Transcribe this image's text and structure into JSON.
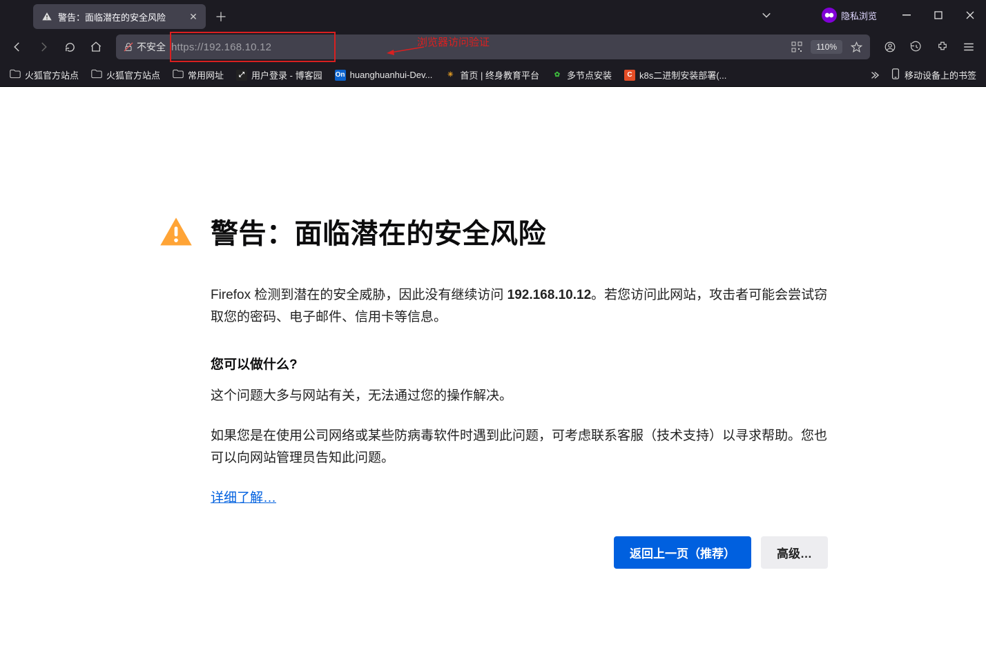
{
  "tab": {
    "title": "警告：面临潜在的安全风险"
  },
  "private_label": "隐私浏览",
  "urlbar": {
    "insecure_label": "不安全",
    "url": "https://192.168.10.12",
    "zoom": "110%"
  },
  "callout": "浏览器访问验证",
  "bookmarks": [
    {
      "label": "火狐官方站点",
      "type": "folder"
    },
    {
      "label": "火狐官方站点",
      "type": "folder"
    },
    {
      "label": "常用网址",
      "type": "folder"
    },
    {
      "label": "用户登录 - 博客园",
      "type": "link",
      "favbg": "#222",
      "favtxt": "⤢",
      "favcolor": "#fff"
    },
    {
      "label": "huanghuanhui-Dev...",
      "type": "link",
      "favbg": "#0b63ce",
      "favtxt": "On",
      "favcolor": "#fff"
    },
    {
      "label": "首页 | 终身教育平台",
      "type": "link",
      "favbg": "transparent",
      "favtxt": "✳",
      "favcolor": "#d92"
    },
    {
      "label": "多节点安装",
      "type": "link",
      "favbg": "transparent",
      "favtxt": "✿",
      "favcolor": "#3dbb3d"
    },
    {
      "label": "k8s二进制安装部署(...",
      "type": "link",
      "favbg": "#e44d26",
      "favtxt": "C",
      "favcolor": "#fff"
    }
  ],
  "bookmark_tail": "移动设备上的书签",
  "page": {
    "heading": "警告：面临潜在的安全风险",
    "para1_a": "Firefox 检测到潜在的安全威胁，因此没有继续访问 ",
    "para1_b_strong": "192.168.10.12",
    "para1_c": "。若您访问此网站，攻击者可能会尝试窃取您的密码、电子邮件、信用卡等信息。",
    "sub_heading": "您可以做什么?",
    "para2": "这个问题大多与网站有关，无法通过您的操作解决。",
    "para3": "如果您是在使用公司网络或某些防病毒软件时遇到此问题，可考虑联系客服（技术支持）以寻求帮助。您也可以向网站管理员告知此问题。",
    "learn_more": "详细了解…",
    "btn_back": "返回上一页（推荐）",
    "btn_adv": "高级…"
  }
}
